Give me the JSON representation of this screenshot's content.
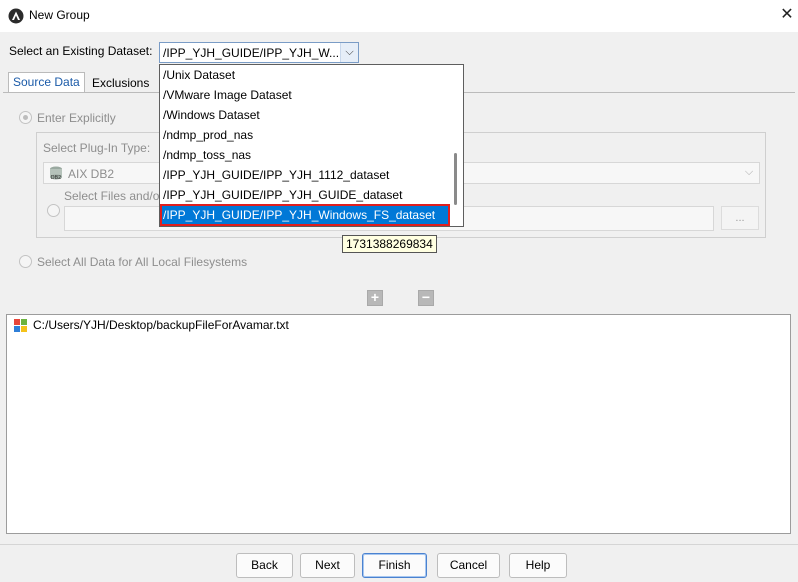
{
  "window": {
    "title": "New Group",
    "close_glyph": "✕"
  },
  "dataset": {
    "label": "Select an Existing Dataset:",
    "value": "/IPP_YJH_GUIDE/IPP_YJH_W...",
    "arrow": "⌵"
  },
  "tabs": [
    {
      "label": "Source Data"
    },
    {
      "label": "Exclusions"
    }
  ],
  "options": {
    "enter_explicitly": "Enter Explicitly",
    "plugin_label": "Select Plug-In Type:",
    "plugin_value": "AIX DB2",
    "plugin_icon_text": "DB2",
    "files_label": "Select Files and/o",
    "browse_label": "...",
    "all_data": "Select All Data for All Local Filesystems"
  },
  "list": {
    "items": [
      "C:/Users/YJH/Desktop/backupFileForAvamar.txt"
    ]
  },
  "dropdown": {
    "items": [
      "/Unix Dataset",
      "/VMware Image Dataset",
      "/Windows Dataset",
      "/ndmp_prod_nas",
      "/ndmp_toss_nas",
      "/IPP_YJH_GUIDE/IPP_YJH_1112_dataset",
      "/IPP_YJH_GUIDE/IPP_YJH_GUIDE_dataset",
      "/IPP_YJH_GUIDE/IPP_YJH_Windows_FS_dataset"
    ],
    "selected_index": 7
  },
  "tooltip": "1731388269834",
  "buttons": {
    "back": "Back",
    "next": "Next",
    "finish": "Finish",
    "cancel": "Cancel",
    "help": "Help",
    "add": "+",
    "remove": "−"
  },
  "colors": {
    "selection": "#0078d7",
    "highlight_outline": "#e01e1e",
    "tab_active_text": "#1a5aa8"
  },
  "icons": {
    "app": "avamar-logo-icon",
    "file": "windows-file-icon",
    "plugin": "db2-icon"
  }
}
